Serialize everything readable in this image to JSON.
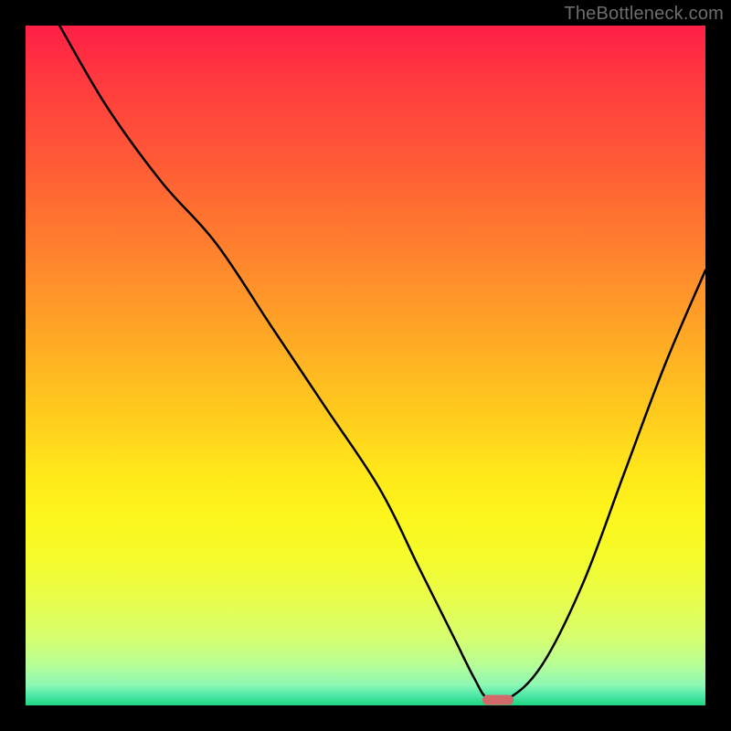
{
  "watermark": "TheBottleneck.com",
  "chart_data": {
    "type": "line",
    "title": "",
    "xlabel": "",
    "ylabel": "",
    "xlim": [
      0,
      100
    ],
    "ylim": [
      0,
      100
    ],
    "x": [
      5,
      12,
      20,
      28,
      36,
      44,
      52,
      58,
      63,
      66,
      68,
      71,
      76,
      82,
      88,
      94,
      100
    ],
    "y": [
      100,
      88,
      77,
      68,
      56,
      44,
      32,
      20,
      10,
      4,
      1,
      1,
      6,
      18,
      34,
      50,
      64
    ],
    "marker": {
      "x": 69.5,
      "y": 0.8
    },
    "gradient_stops": [
      {
        "pos": 0,
        "color": "#ff1f46"
      },
      {
        "pos": 32,
        "color": "#ff7e2e"
      },
      {
        "pos": 66,
        "color": "#ffe81a"
      },
      {
        "pos": 90,
        "color": "#d6fe6e"
      },
      {
        "pos": 100,
        "color": "#1ed37f"
      }
    ]
  }
}
